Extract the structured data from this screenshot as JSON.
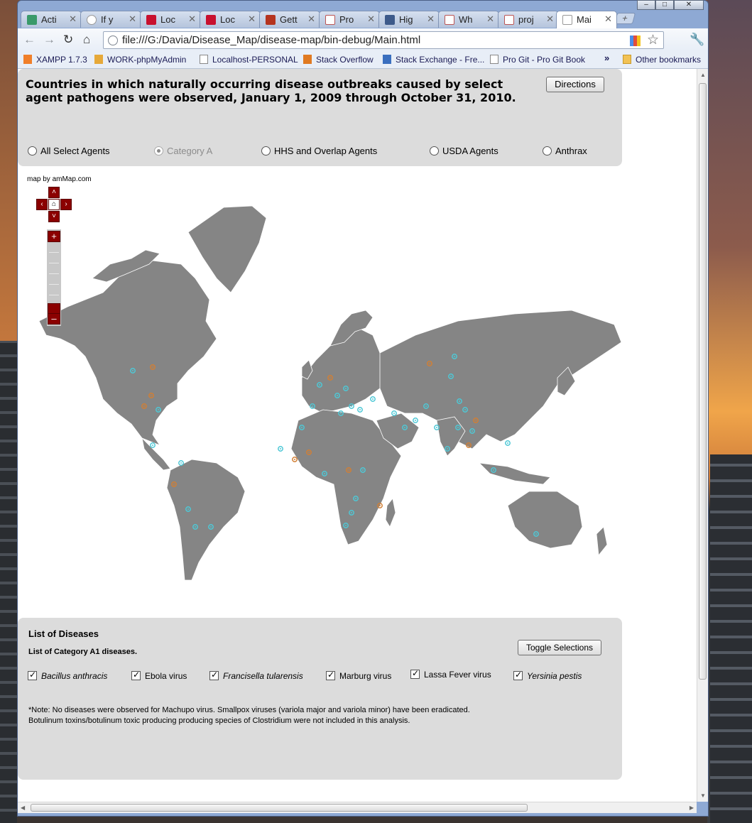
{
  "browser": {
    "tabs": [
      {
        "label": "Acti",
        "icon": "app-icon"
      },
      {
        "label": "If y",
        "icon": "reddit-icon"
      },
      {
        "label": "Loc",
        "icon": "adobe-icon"
      },
      {
        "label": "Loc",
        "icon": "adobe-icon"
      },
      {
        "label": "Gett",
        "icon": "plus-cross-icon"
      },
      {
        "label": "Pro",
        "icon": "arch-icon"
      },
      {
        "label": "Hig",
        "icon": "chart-icon"
      },
      {
        "label": "Wh",
        "icon": "arch-icon"
      },
      {
        "label": "proj",
        "icon": "arch-icon"
      },
      {
        "label": "Mai",
        "icon": "page-icon"
      }
    ],
    "url": "file:///G:/Davia/Disease_Map/disease-map/bin-debug/Main.html",
    "bookmarks": [
      "XAMPP 1.7.3",
      "WORK-phpMyAdmin",
      "Localhost-PERSONAL",
      "Stack Overflow",
      "Stack Exchange - Fre...",
      "Pro Git - Pro Git Book"
    ],
    "more_bookmarks": "»",
    "other_bookmarks": "Other bookmarks"
  },
  "page": {
    "title": "Countries in which naturally occurring disease outbreaks caused by select agent pathogens were observed, January 1, 2009 through October 31, 2010.",
    "directions_label": "Directions",
    "radio_options": [
      {
        "label": "All Select Agents",
        "selected": false,
        "disabled": false
      },
      {
        "label": "Category A",
        "selected": true,
        "disabled": true
      },
      {
        "label": "HHS and Overlap Agents",
        "selected": false,
        "disabled": false
      },
      {
        "label": "USDA Agents",
        "selected": false,
        "disabled": false
      },
      {
        "label": "Anthrax",
        "selected": false,
        "disabled": false
      }
    ],
    "map_credit": "map by amMap.com",
    "list_title": "List of Diseases",
    "list_subtitle": "List of Category A1 diseases.",
    "toggle_label": "Toggle Selections",
    "diseases": [
      {
        "label": "Bacillus anthracis",
        "italic": true,
        "checked": true
      },
      {
        "label": "Ebola virus",
        "italic": false,
        "checked": true
      },
      {
        "label": "Francisella tularensis",
        "italic": true,
        "checked": true
      },
      {
        "label": "Marburg virus",
        "italic": false,
        "checked": true
      },
      {
        "label": "Lassa Fever virus",
        "italic": false,
        "checked": true
      },
      {
        "label": "Yersinia pestis",
        "italic": true,
        "checked": true
      }
    ],
    "note": "*Note: No diseases were observed for Machupo virus.  Smallpox viruses (variola major and variola minor) have been eradicated. Botulinum toxins/botulinum toxic producing producing species of Clostridium were not included in this analysis."
  },
  "colors": {
    "map_land": "#858585",
    "marker_cyan": "#4ec8d6",
    "marker_orange": "#d27f34",
    "map_control": "#8b0000"
  }
}
